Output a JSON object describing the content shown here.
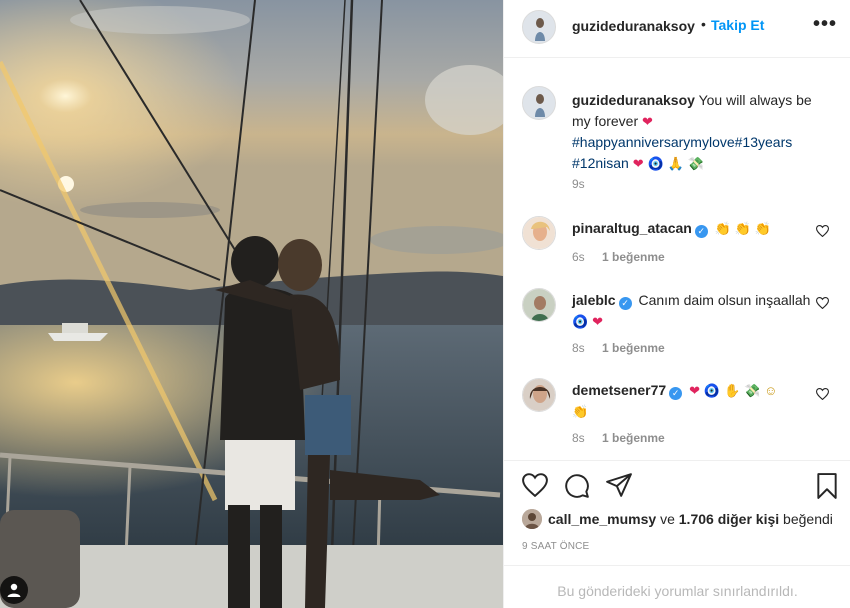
{
  "post": {
    "photo_alt": "couple kissing on a boat at sunset",
    "user_badge_icon": "user-icon"
  },
  "header": {
    "username": "guzideduranaksoy",
    "separator": "•",
    "follow_label": "Takip Et",
    "more_label": "•••"
  },
  "caption": {
    "username": "guzideduranaksoy",
    "text": "You will always be my forever",
    "hashtags": "#happyanniversarymylove#13years #12nisan",
    "time": "9s"
  },
  "comments": [
    {
      "username": "pinaraltug_atacan",
      "verified": true,
      "text": "",
      "time": "6s",
      "likes": "1 beğenme"
    },
    {
      "username": "jaleblc",
      "verified": true,
      "text": "Canım daim olsun inşaallah",
      "time": "8s",
      "likes": "1 beğenme"
    },
    {
      "username": "demetsener77",
      "verified": true,
      "text": "",
      "time": "8s",
      "likes": "1 beğenme"
    }
  ],
  "liked_by": {
    "first_user": "call_me_mumsy",
    "connector": " ve ",
    "others": "1.706 diğer kişi",
    "suffix": " beğendi"
  },
  "post_time": "9 SAAT ÖNCE",
  "footer_notice": "Bu gönderideki yorumlar sınırlandırıldı.",
  "icons": {
    "like": "heart-icon",
    "comment": "comment-icon",
    "share": "share-icon",
    "save": "bookmark-icon"
  },
  "colors": {
    "accent": "#0095f6",
    "verified": "#3897f0",
    "heart": "#e0245e",
    "muted": "#8e8e8e"
  }
}
